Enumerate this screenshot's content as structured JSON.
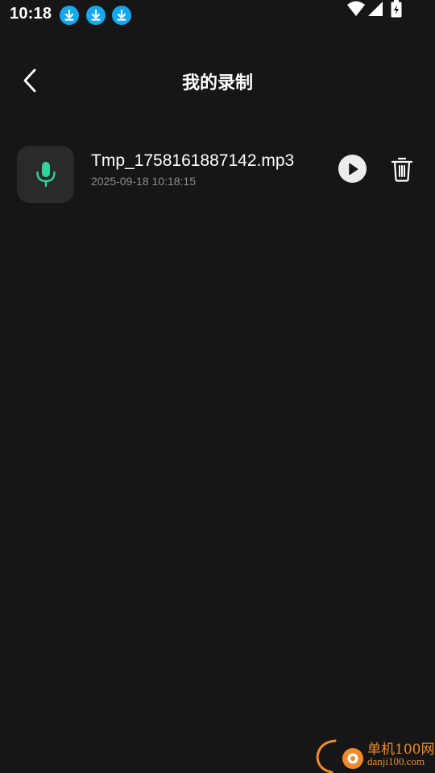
{
  "status_bar": {
    "time": "10:18",
    "notifications": [
      "download-icon",
      "download-icon",
      "download-icon"
    ],
    "system_icons": [
      "wifi-icon",
      "signal-icon",
      "battery-charging-icon"
    ]
  },
  "header": {
    "title": "我的录制",
    "back_icon": "chevron-left-icon"
  },
  "recordings": [
    {
      "name": "Tmp_1758161887142.mp3",
      "datetime": "2025-09-18 10:18:15",
      "icon": "microphone-icon",
      "actions": [
        "play-icon",
        "trash-icon"
      ]
    }
  ],
  "watermark": {
    "name": "单机100网",
    "domain": "danji100.com"
  },
  "colors": {
    "background": "#161616",
    "tile": "#2a2a2c",
    "mic_accent": "#2fd39a",
    "download_badge": "#13a8f0",
    "secondary_text": "#8c8c8c",
    "watermark": "#f08a2a"
  }
}
